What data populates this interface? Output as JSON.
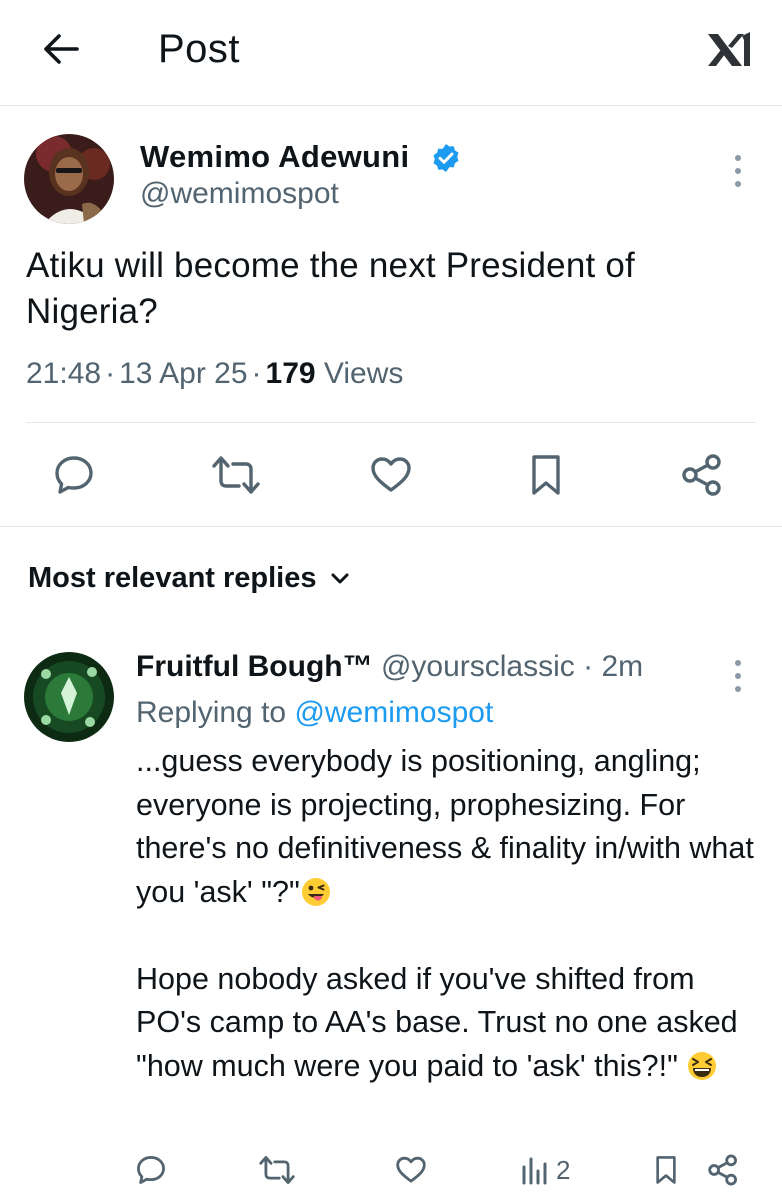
{
  "header": {
    "title": "Post"
  },
  "post": {
    "author_name": "Wemimo Adewuni",
    "author_handle": "@wemimospot",
    "text": "Atiku will become the next President of Nigeria?",
    "time": "21:48",
    "date": "13 Apr 25",
    "views_count": "179",
    "views_label": "Views"
  },
  "replies_section": {
    "sort_label": "Most relevant replies"
  },
  "reply": {
    "author_name": "Fruitful Bough™",
    "author_handle": "@yoursclassic",
    "age": "· 2m",
    "replying_to_label": "Replying to",
    "replying_to_handle": "@wemimospot",
    "paragraph1": "...guess everybody is positioning, angling; everyone is projecting, prophesizing. For there's no definitiveness & finality in/with what you 'ask' \"?\"",
    "paragraph2": "Hope nobody asked if you've shifted from PO's camp to AA's base. Trust no one asked \"how much were you paid to 'ask' this?!\"",
    "views_count": "2"
  },
  "icons": {
    "back": "arrow-left-icon",
    "brand": "xi-logo",
    "verified": "verified-badge-icon",
    "more": "more-vertical-icon",
    "reply": "comment-icon",
    "repost": "repost-icon",
    "like": "heart-icon",
    "bookmark": "bookmark-icon",
    "share": "share-icon",
    "views": "bar-chart-icon"
  },
  "colors": {
    "accent": "#1d9bf0",
    "text_secondary": "#536471",
    "divider": "#e6e8ea"
  }
}
